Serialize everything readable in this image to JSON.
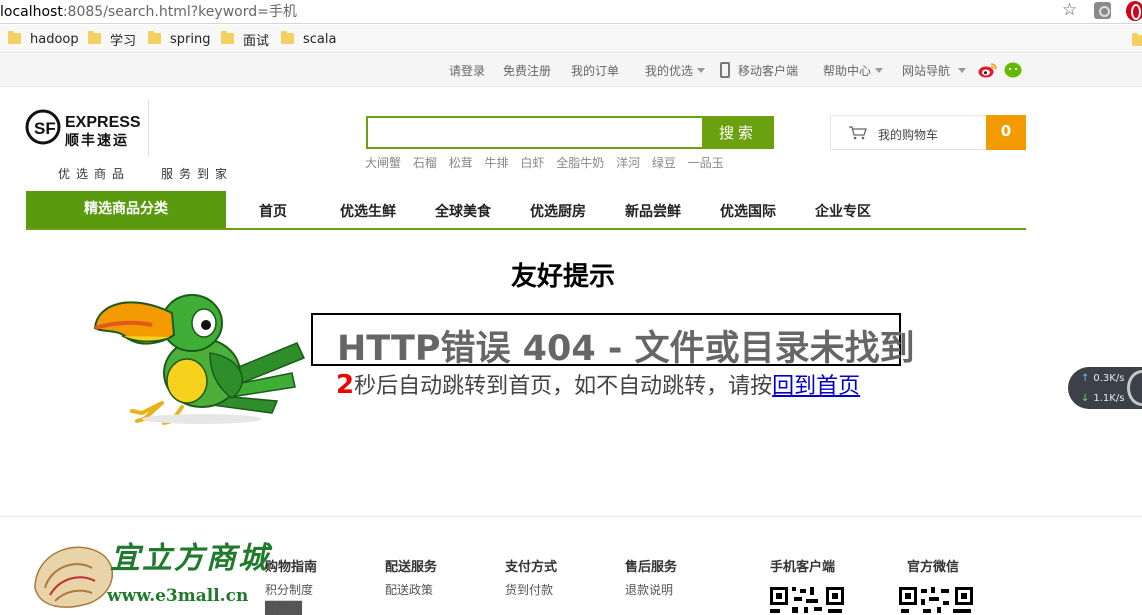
{
  "browser": {
    "url_host": "localhost",
    "url_rest": ":8085/search.html?keyword=手机",
    "bookmarks": [
      "hadoop",
      "学习",
      "spring",
      "面试",
      "scala"
    ]
  },
  "topbar": {
    "links": [
      "请登录",
      "免费注册",
      "我的订单",
      "我的优选",
      "移动客户端",
      "帮助中心",
      "网站导航"
    ]
  },
  "header": {
    "logo_text": "EXPRESS",
    "logo_sub": "顺丰速运",
    "slogan_left": "优选商品",
    "slogan_right": "服务到家",
    "search_button": "搜索",
    "search_value": "",
    "hotwords": [
      "大闸蟹",
      "石榴",
      "松茸",
      "牛排",
      "白虾",
      "全脂牛奶",
      "洋河",
      "绿豆",
      "一品玉"
    ],
    "cart_label": "我的购物车",
    "cart_count": "0"
  },
  "nav": {
    "category_label": "精选商品分类",
    "items": [
      "首页",
      "优选生鲜",
      "全球美食",
      "优选厨房",
      "新品尝鲜",
      "优选国际",
      "企业专区"
    ]
  },
  "error": {
    "title": "友好提示",
    "message": "HTTP错误 404 - 文件或目录未找到",
    "countdown": "2",
    "redirect_text": "秒后自动跳转到首页，如不自动跳转，请按",
    "home_link": "回到首页"
  },
  "speed_widget": {
    "up": "0.3K/s",
    "down": "1.1K/s"
  },
  "footer": {
    "logo_text": "宜立方商城",
    "logo_url": "www.e3mall.cn",
    "columns": [
      {
        "title": "购物指南",
        "links": [
          "积分制度"
        ]
      },
      {
        "title": "配送服务",
        "links": [
          "配送政策"
        ]
      },
      {
        "title": "支付方式",
        "links": [
          "货到付款"
        ]
      },
      {
        "title": "售后服务",
        "links": [
          "退款说明"
        ]
      },
      {
        "title": "手机客户端",
        "links": []
      },
      {
        "title": "官方微信",
        "links": []
      }
    ]
  },
  "colors": {
    "brand_green": "#6ba10f",
    "cart_orange": "#f29a00",
    "countdown_red": "#e00000",
    "link_blue": "#0000cc"
  }
}
